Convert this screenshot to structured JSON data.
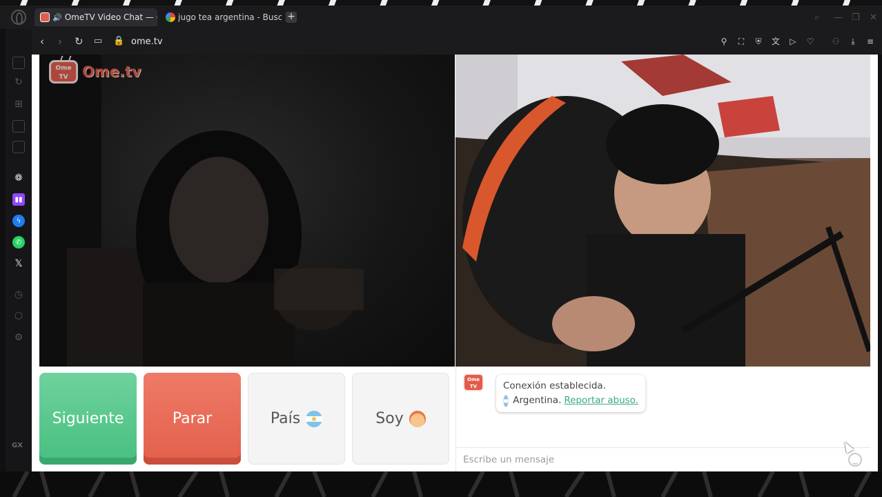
{
  "browser": {
    "tabs": [
      {
        "title": "OmeTV Video Chat — (",
        "active": true,
        "audio": true
      },
      {
        "title": "jugo tea argentina - Busca",
        "active": false,
        "audio": false
      }
    ],
    "new_tab_label": "+",
    "url": "ome.tv"
  },
  "sidebar": {
    "icons": [
      "gaming-icon",
      "refresh-icon",
      "cart-icon",
      "image-icon",
      "mail-icon",
      "chatgpt-icon",
      "twitch-icon",
      "messenger-icon",
      "whatsapp-icon",
      "x-icon",
      "history-icon",
      "extensions-icon",
      "settings-icon"
    ],
    "gx_label": "GX"
  },
  "page": {
    "logo_text": "Ome.tv",
    "logo_badge": "Ome TV",
    "buttons": {
      "next": "Siguiente",
      "stop": "Parar",
      "country": "País",
      "gender": "Soy"
    },
    "chat": {
      "status": "Conexión establecida.",
      "country": "Argentina.",
      "report_link": "Reportar abuso.",
      "input_placeholder": "Escribe un mensaje"
    }
  },
  "colors": {
    "next_green": "#47bf80",
    "stop_red": "#e2604c",
    "brand_red": "#e25b4b",
    "link_green": "#3aa980"
  }
}
